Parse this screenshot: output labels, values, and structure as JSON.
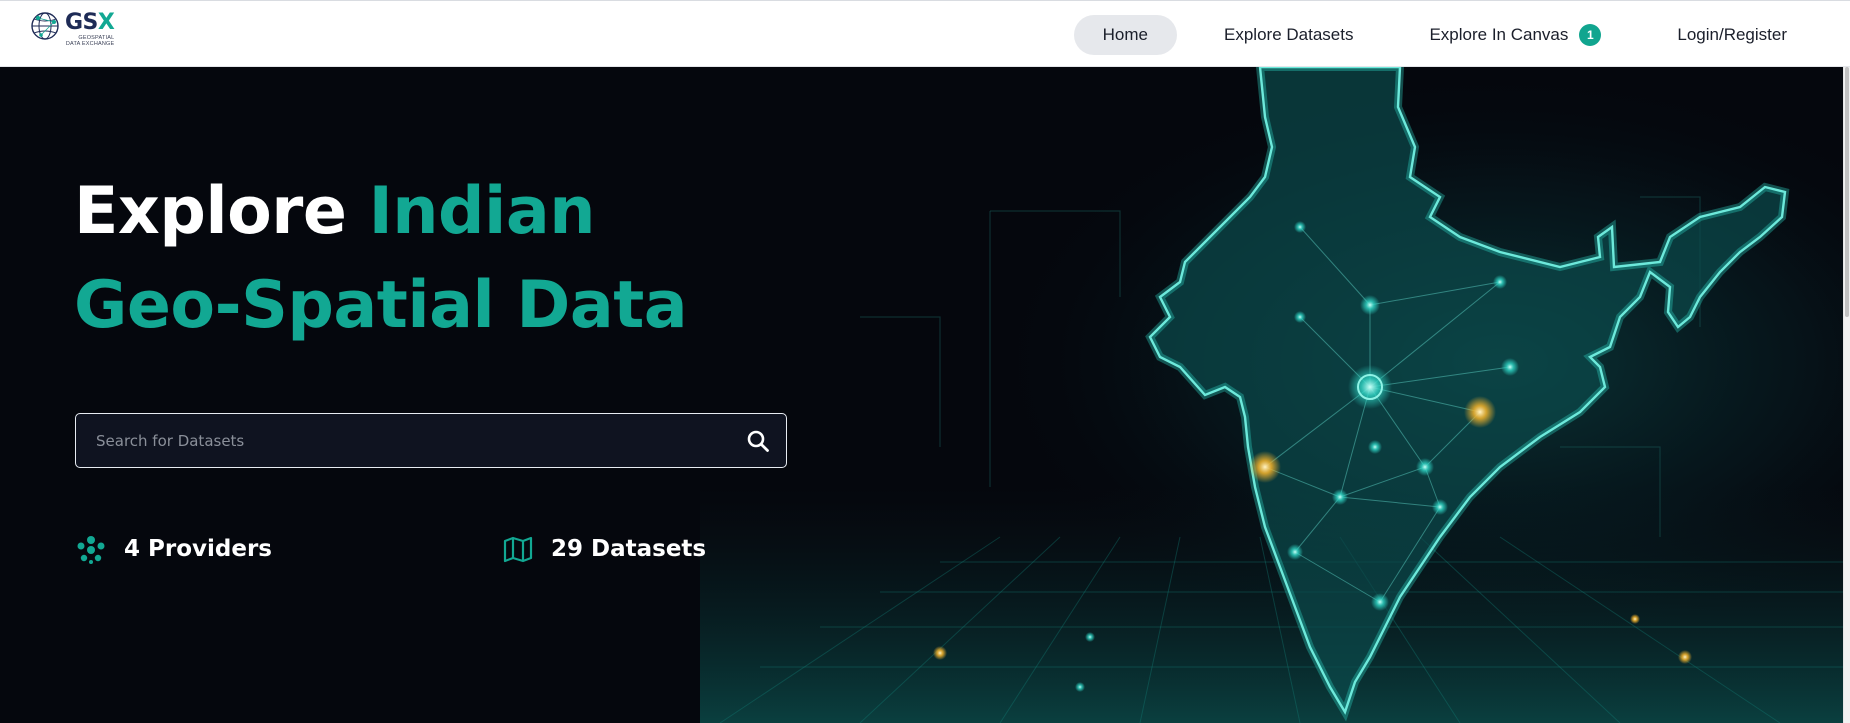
{
  "header": {
    "logo": {
      "mark": "GS",
      "mark_x": "X",
      "sub_line1": "GEOSPATIAL",
      "sub_line2": "DATA EXCHANGE"
    },
    "nav": [
      {
        "label": "Home",
        "active": true
      },
      {
        "label": "Explore Datasets",
        "active": false
      },
      {
        "label": "Explore In Canvas",
        "active": false,
        "badge": "1"
      },
      {
        "label": "Login/Register",
        "active": false
      }
    ]
  },
  "hero": {
    "headline_part1": "Explore ",
    "headline_accent1": "Indian",
    "headline_accent2": "Geo-Spatial Data",
    "search": {
      "placeholder": "Search for Datasets",
      "value": ""
    },
    "stats": {
      "providers": "4 Providers",
      "datasets": "29 Datasets"
    }
  },
  "icons": {
    "logo": "globe-network-icon",
    "search": "magnifier-icon",
    "providers": "cluster-dots-icon",
    "datasets": "folded-map-icon"
  },
  "colors": {
    "accent": "#12a893",
    "brand_navy": "#1e2b56",
    "hero_background": "#05070d",
    "nav_active": "#e6e8ec"
  }
}
